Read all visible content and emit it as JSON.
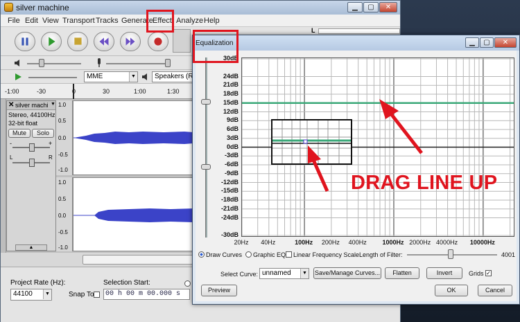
{
  "main_window": {
    "title": "silver machine",
    "menu": [
      "File",
      "Edit",
      "View",
      "Transport",
      "Tracks",
      "Generate",
      "Effect",
      "Analyze",
      "Help"
    ],
    "meter_label": "L",
    "host_value": "MME",
    "output_device": "Speakers (Realt",
    "ruler_labels": [
      "-1:00",
      "-30",
      "0",
      "30",
      "1:00",
      "1:30"
    ],
    "track": {
      "name": "silver machi",
      "info_line1": "Stereo, 44100Hz",
      "info_line2": "32-bit float",
      "mute_label": "Mute",
      "solo_label": "Solo",
      "pan_left": "L",
      "pan_right": "R",
      "gain_minus": "-",
      "gain_plus": "+"
    },
    "scale_labels_top": [
      "1.0",
      "0.5",
      "0.0",
      "-0.5",
      "-1.0"
    ],
    "scale_labels_bottom": [
      "1.0",
      "0.5",
      "0.0",
      "-0.5",
      "-1.0"
    ],
    "project_rate_label": "Project Rate (Hz):",
    "project_rate_value": "44100",
    "snap_to_label": "Snap To",
    "selection_start_label": "Selection Start:",
    "selection_start_value": "00 h 00 m 00.000 s"
  },
  "eq_dialog": {
    "title": "Equalization",
    "db_labels": [
      "30dB",
      "24dB",
      "21dB",
      "18dB",
      "15dB",
      "12dB",
      "9dB",
      "6dB",
      "3dB",
      "0dB",
      "-3dB",
      "-6dB",
      "-9dB",
      "-12dB",
      "-15dB",
      "-18dB",
      "-21dB",
      "-24dB",
      "-30dB"
    ],
    "hz_labels": [
      "20Hz",
      "40Hz",
      "100Hz",
      "200Hz",
      "400Hz",
      "1000Hz",
      "2000Hz",
      "4000Hz",
      "10000Hz"
    ],
    "draw_curves_label": "Draw Curves",
    "graphic_eq_label": "Graphic EQ",
    "linear_freq_label": "Linear Frequency Scale",
    "filter_length_label": "Length of Filter:",
    "filter_length_value": "4001",
    "select_curve_label": "Select Curve:",
    "select_curve_value": "unnamed",
    "save_manage_label": "Save/Manage Curves...",
    "flatten_label": "Flatten",
    "invert_label": "Invert",
    "grids_label": "Grids",
    "preview_label": "Preview",
    "ok_label": "OK",
    "cancel_label": "Cancel",
    "curve_value_db": 15
  },
  "annotation": {
    "text": "DRAG LINE UP"
  },
  "colors": {
    "accent_red": "#e0141e",
    "curve_green": "#3aa878",
    "waveform_blue": "#3b43c8"
  }
}
